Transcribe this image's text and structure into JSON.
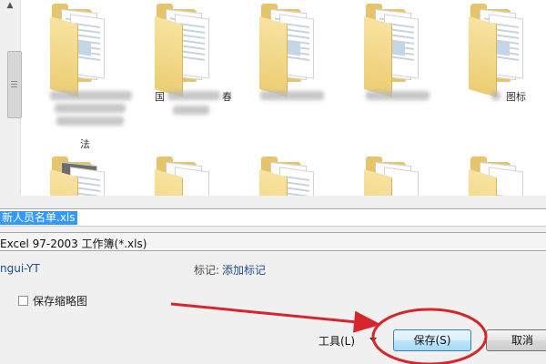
{
  "folders": {
    "row1": [
      {
        "label": ""
      },
      {
        "label": "国"
      },
      {
        "label": ""
      },
      {
        "label": ""
      },
      {
        "label": "图标"
      }
    ],
    "partial_label": "法",
    "partial_label_2": "春"
  },
  "save_form": {
    "filename_value": "新人员名单.xls",
    "filetype_value": "Excel 97-2003 工作簿(*.xls)",
    "author_value": "ngui-YT",
    "tags_label": "标记:",
    "tags_link": "添加标记",
    "thumbnail_label": "保存缩略图",
    "tools_label": "工具(L)",
    "save_label": "保存(S)",
    "cancel_label": "取消"
  },
  "colors": {
    "selection": "#3399ff",
    "annotation": "#d6262b",
    "link": "#1e4c8c"
  }
}
